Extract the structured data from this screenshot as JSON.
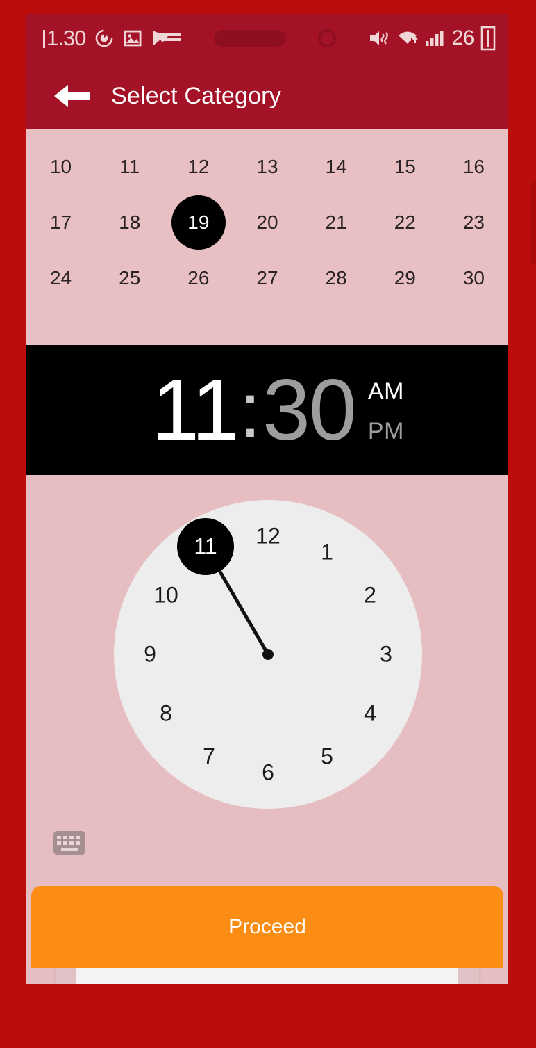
{
  "theme": {
    "frame_red": "#bd0c0c",
    "appbar_red": "#a31226",
    "pink_bg": "#e6bec2",
    "clock_face": "#eeeded",
    "accent_orange": "#fb8c14",
    "selection_black": "#000000"
  },
  "status_bar": {
    "left_label": "1.30",
    "icons_left": [
      "sync-icon",
      "image-icon",
      "flag-check-icon"
    ],
    "camera_pill": "pill-camera-cutout",
    "camera_circle": "circle-camera-cutout",
    "icons_right": [
      "mute-vibrate-icon",
      "wifi-icon",
      "signal-bars-icon"
    ],
    "battery_percent": "26",
    "battery_icon": "battery-icon"
  },
  "app_bar": {
    "back_icon": "back-arrow-icon",
    "title": "Select Category"
  },
  "calendar": {
    "rows": [
      [
        "10",
        "11",
        "12",
        "13",
        "14",
        "15",
        "16"
      ],
      [
        "17",
        "18",
        "19",
        "20",
        "21",
        "22",
        "23"
      ],
      [
        "24",
        "25",
        "26",
        "27",
        "28",
        "29",
        "30"
      ]
    ],
    "selected_day": "19"
  },
  "time_display": {
    "hour": "11",
    "separator": ":",
    "minute": "30",
    "am_label": "AM",
    "pm_label": "PM",
    "selected_field": "hour",
    "selected_meridiem": "AM"
  },
  "clock_picker": {
    "mode": "hours",
    "numbers": [
      "12",
      "1",
      "2",
      "3",
      "4",
      "5",
      "6",
      "7",
      "8",
      "9",
      "10",
      "11"
    ],
    "selected_value": "11",
    "keyboard_toggle_icon": "keyboard-icon"
  },
  "footer": {
    "proceed_label": "Proceed"
  }
}
